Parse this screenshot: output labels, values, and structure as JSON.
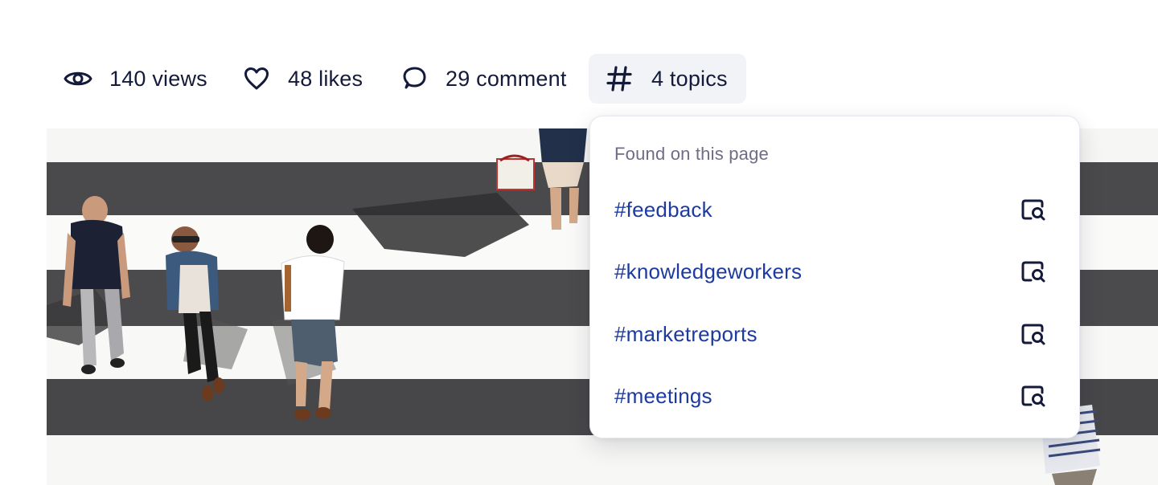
{
  "stats": {
    "views": {
      "icon": "eye-icon",
      "label": "140 views"
    },
    "likes": {
      "icon": "heart-icon",
      "label": "48 likes"
    },
    "comments": {
      "icon": "comment-icon",
      "label": "29 comment"
    },
    "topics": {
      "icon": "hashtag-icon",
      "label": "4 topics"
    }
  },
  "hero": {
    "alt": "crosswalk-photo"
  },
  "dropdown": {
    "heading": "Found on this page",
    "items": [
      {
        "label": "#feedback",
        "icon": "find-on-page-icon"
      },
      {
        "label": "#knowledgeworkers",
        "icon": "find-on-page-icon"
      },
      {
        "label": "#marketreports",
        "icon": "find-on-page-icon"
      },
      {
        "label": "#meetings",
        "icon": "find-on-page-icon"
      }
    ]
  },
  "colors": {
    "text": "#141a3a",
    "link": "#1c3aa0",
    "muted": "#6f6c86",
    "chip_bg": "#f2f3f6"
  }
}
